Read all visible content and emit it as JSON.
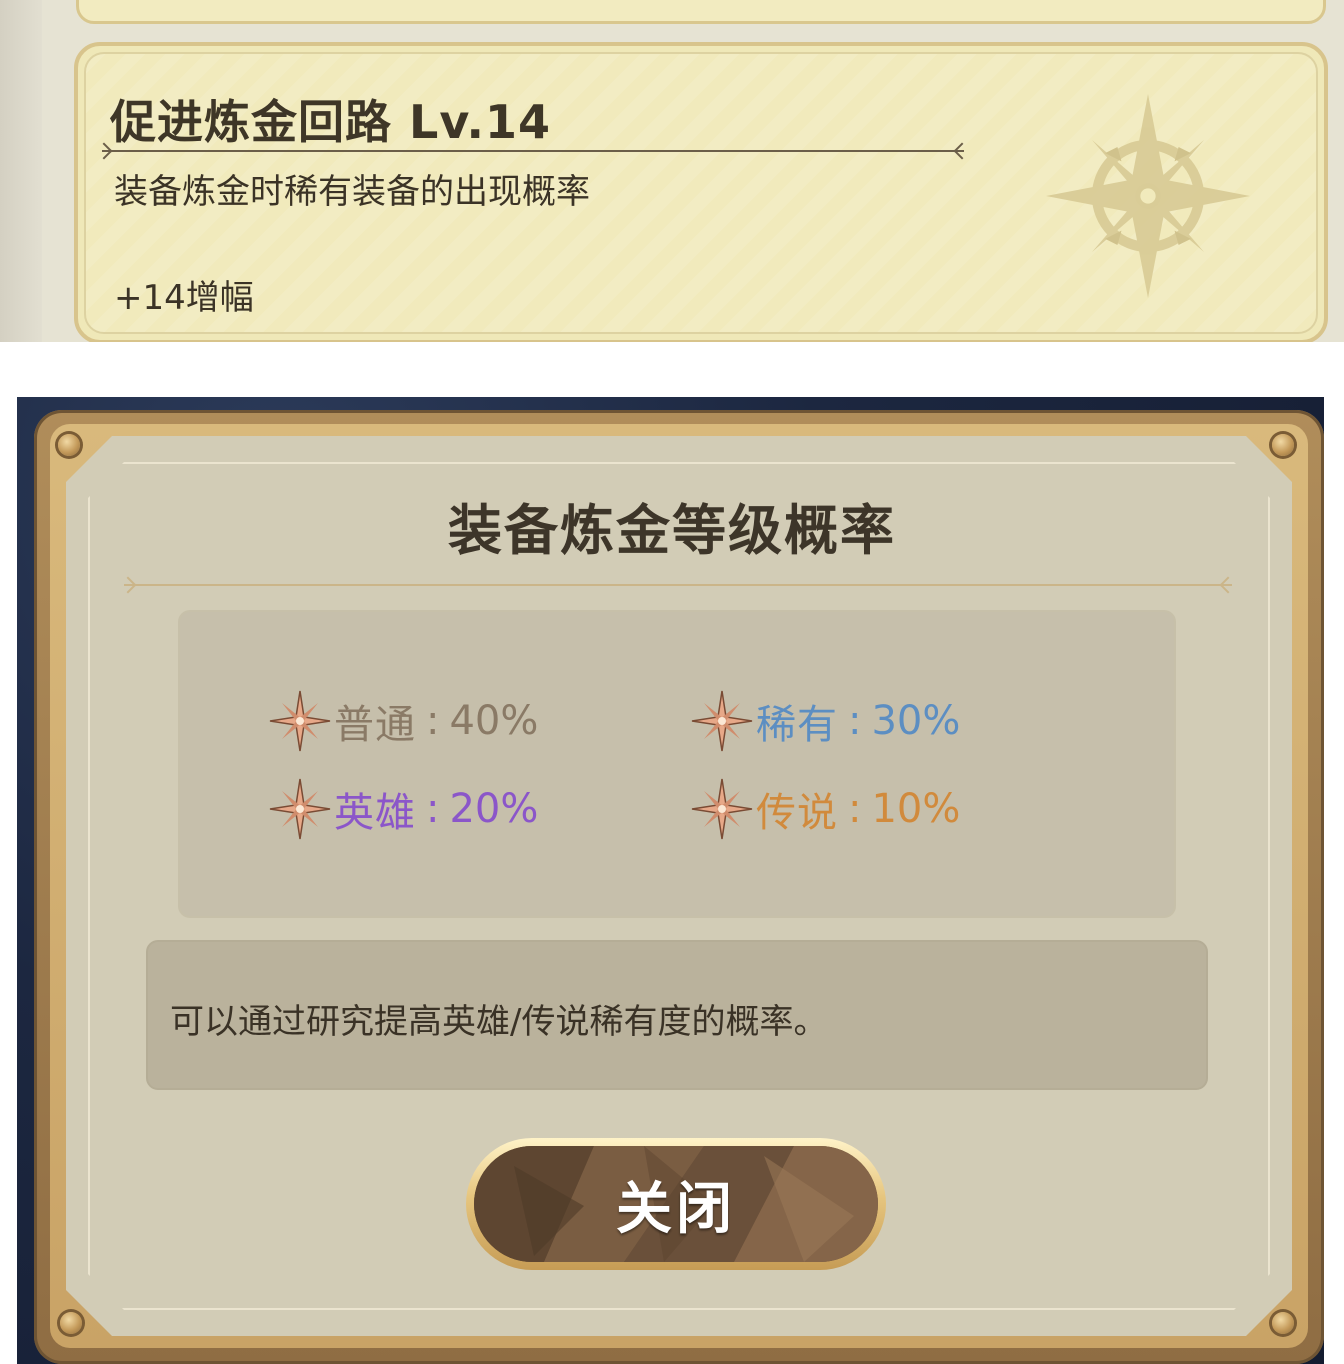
{
  "research_card": {
    "title": "促进炼金回路 Lv.14",
    "description": "装备炼金时稀有装备的出现概率",
    "bonus": "+14增幅",
    "emblem_icon": "compass-star-icon"
  },
  "modal": {
    "title": "装备炼金等级概率",
    "rates": [
      {
        "name": "普通",
        "sep": ":",
        "value": "40%",
        "color": "#8a7a66"
      },
      {
        "name": "稀有",
        "sep": ":",
        "value": "30%",
        "color": "#5c8ec2"
      },
      {
        "name": "英雄",
        "sep": ":",
        "value": "20%",
        "color": "#8b56c9"
      },
      {
        "name": "传说",
        "sep": ":",
        "value": "10%",
        "color": "#d18a3c"
      }
    ],
    "rate_icon": "rarity-star-icon",
    "note": "可以通过研究提高英雄/传说稀有度的概率。",
    "close_label": "关闭"
  }
}
